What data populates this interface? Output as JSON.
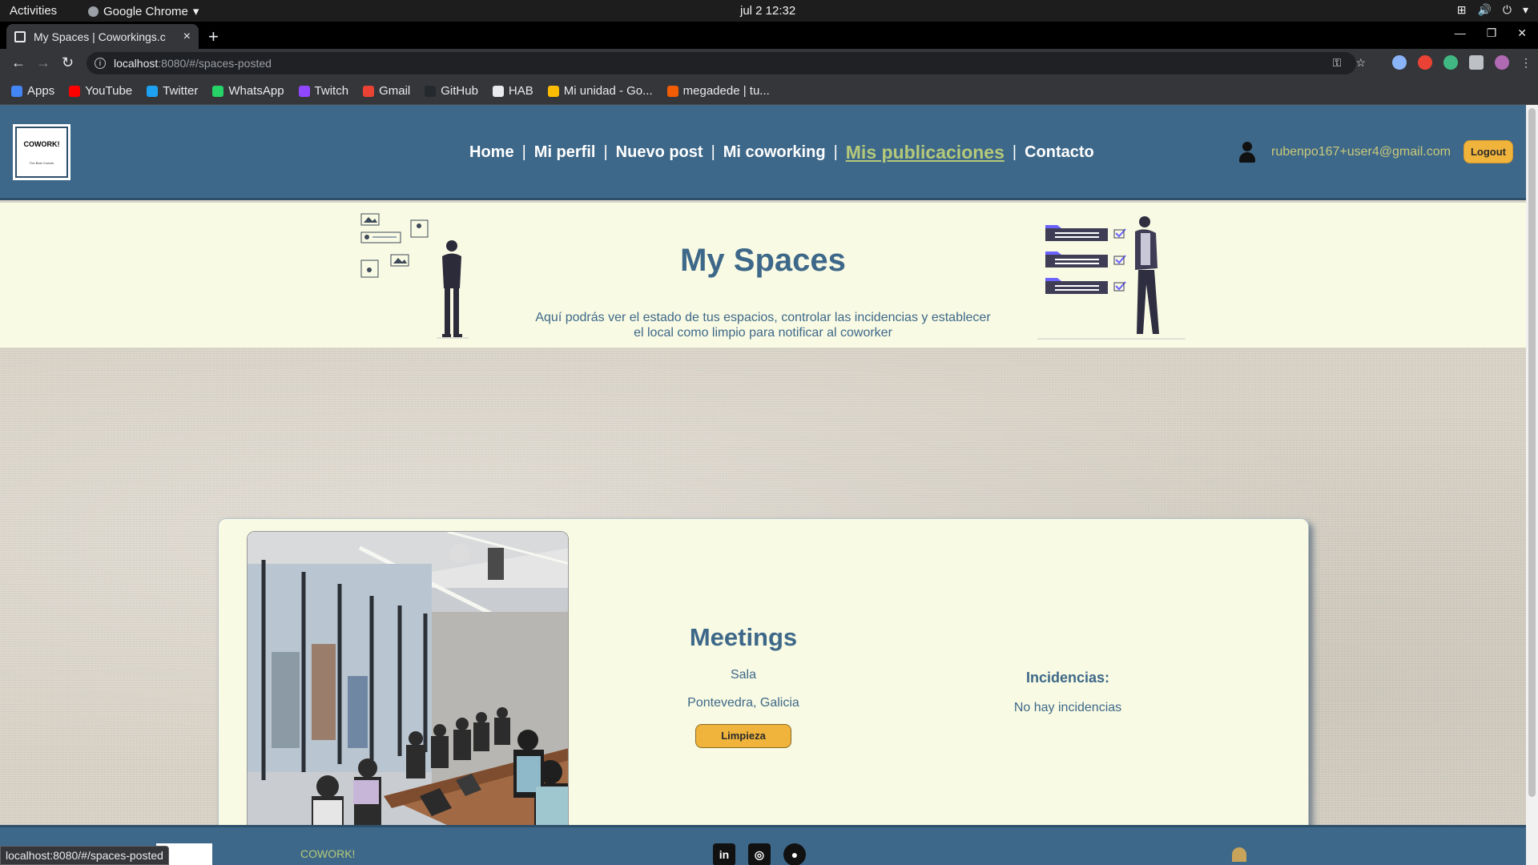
{
  "os": {
    "activities": "Activities",
    "app_name": "Google Chrome",
    "clock": "jul 2  12:32"
  },
  "browser": {
    "tab_title": "My Spaces | Coworkings.c",
    "url_host": "localhost",
    "url_path": ":8080/#/spaces-posted",
    "bookmarks": [
      {
        "label": "Apps",
        "color": "#4285f4"
      },
      {
        "label": "YouTube",
        "color": "#ff0000"
      },
      {
        "label": "Twitter",
        "color": "#1da1f2"
      },
      {
        "label": "WhatsApp",
        "color": "#25d366"
      },
      {
        "label": "Twitch",
        "color": "#9146ff"
      },
      {
        "label": "Gmail",
        "color": "#ea4335"
      },
      {
        "label": "GitHub",
        "color": "#24292e"
      },
      {
        "label": "HAB",
        "color": "#e8eaed"
      },
      {
        "label": "Mi unidad - Go...",
        "color": "#fbbc04"
      },
      {
        "label": "megadede | tu...",
        "color": "#f25c05"
      }
    ],
    "status_url": "localhost:8080/#/spaces-posted"
  },
  "header": {
    "logo_text": "COWORK!",
    "logo_sub": "The Best Cowork",
    "nav": [
      {
        "label": "Home",
        "active": false
      },
      {
        "label": "Mi perfil",
        "active": false
      },
      {
        "label": "Nuevo post",
        "active": false
      },
      {
        "label": "Mi coworking",
        "active": false
      },
      {
        "label": "Mis publicaciones",
        "active": true
      },
      {
        "label": "Contacto",
        "active": false
      }
    ],
    "separator": "|",
    "user_email": "rubenpo167+user4@gmail.com",
    "logout_label": "Logout"
  },
  "hero": {
    "title": "My Spaces",
    "description": "Aquí podrás ver el estado de tus espacios, controlar las incidencias y establecer el local como limpio para notificar al coworker"
  },
  "space": {
    "name": "Meetings",
    "type": "Sala",
    "location": "Pontevedra, Galicia",
    "clean_button": "Limpieza",
    "incidents_title": "Incidencias:",
    "incidents_text": "No hay incidencias"
  },
  "footer": {
    "brand": "COWORK!"
  },
  "colors": {
    "primary": "#3e6889",
    "accent": "#f0b43c",
    "active_link": "#b5c97a",
    "panel": "#f8fae3"
  }
}
